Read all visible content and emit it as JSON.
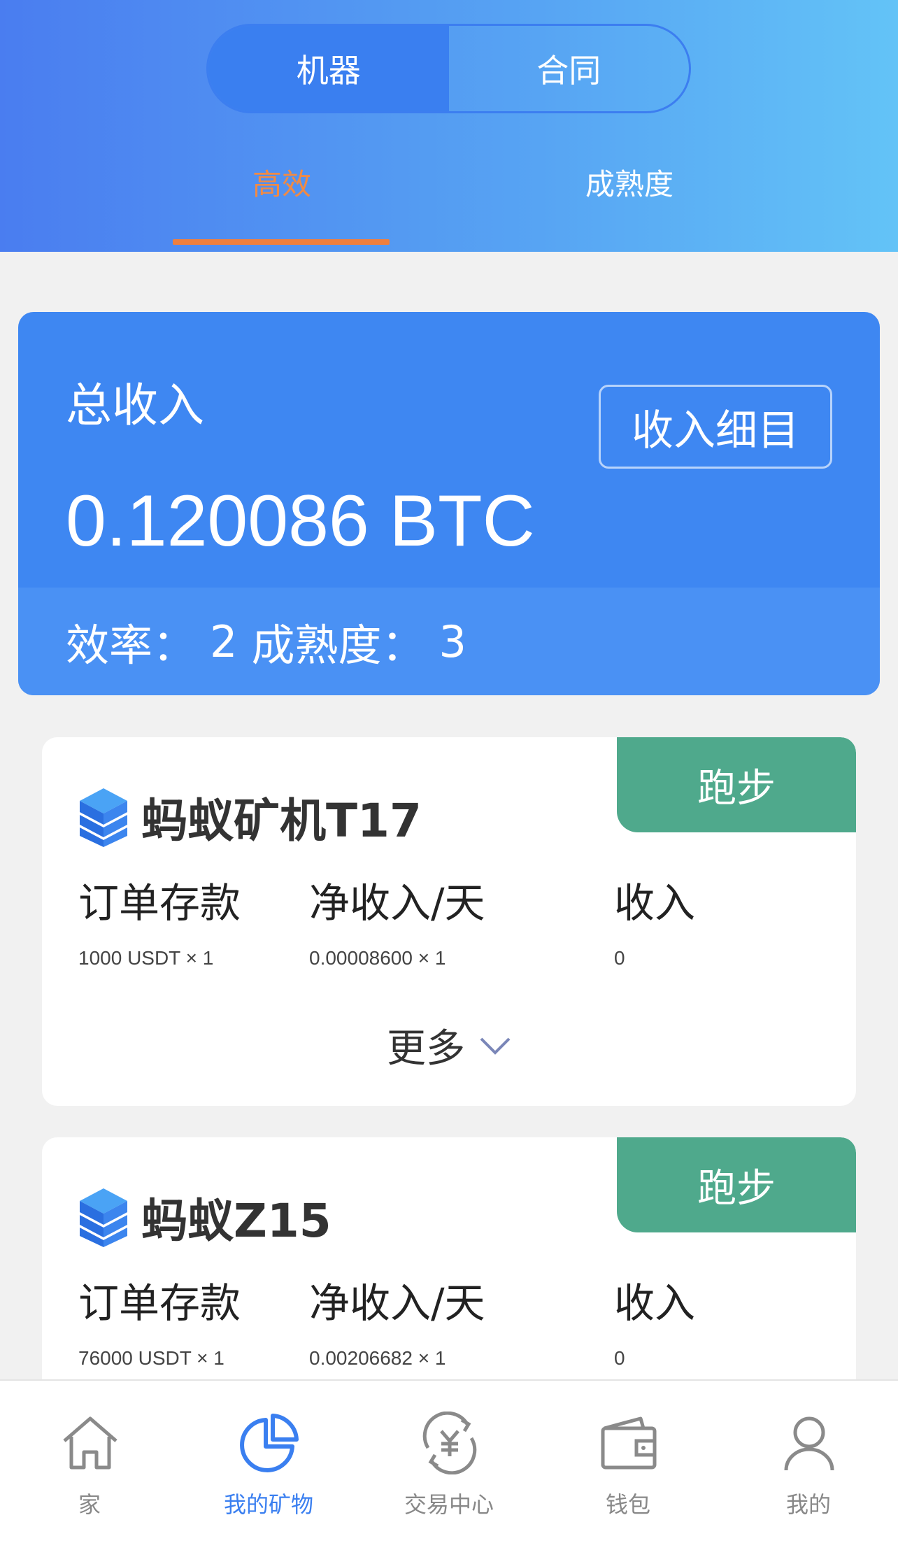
{
  "segment": {
    "machine": "机器",
    "contract": "合同"
  },
  "subtabs": {
    "efficient": "高效",
    "maturity": "成熟度"
  },
  "summary": {
    "title": "总收入",
    "value": "0.120086 BTC",
    "detail_button": "收入细目",
    "efficiency_label": "效率：",
    "efficiency_value": "2",
    "maturity_label": "成熟度：",
    "maturity_value": "3"
  },
  "cards": [
    {
      "name": "蚂蚁矿机T17",
      "badge": "跑步",
      "col_deposit": "订单存款",
      "col_net": "净收入/天",
      "col_income": "收入",
      "deposit": "1000 USDT × 1",
      "net": "0.00008600 × 1",
      "income": "0",
      "more": "更多"
    },
    {
      "name": "蚂蚁Z15",
      "badge": "跑步",
      "col_deposit": "订单存款",
      "col_net": "净收入/天",
      "col_income": "收入",
      "deposit": "76000 USDT × 1",
      "net": "0.00206682 × 1",
      "income": "0"
    }
  ],
  "tabbar": {
    "home": "家",
    "my_mining": "我的矿物",
    "exchange": "交易中心",
    "wallet": "钱包",
    "mine": "我的"
  },
  "colors": {
    "primary": "#3a7ff0",
    "badge": "#4fa98c",
    "accent": "#ef7f3e"
  }
}
